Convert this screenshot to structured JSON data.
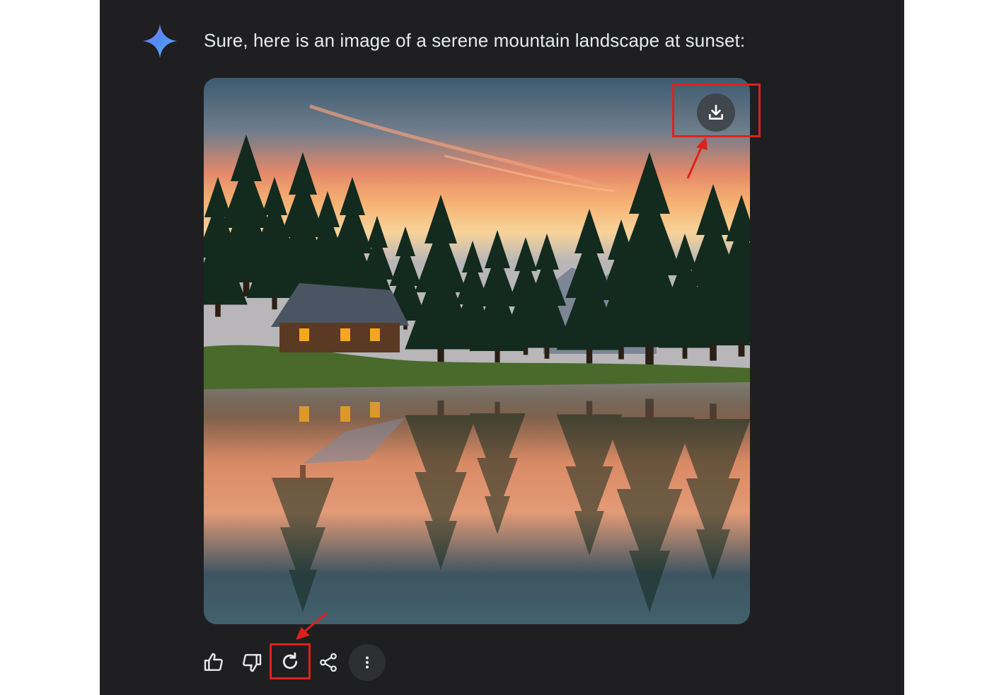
{
  "response": {
    "message": "Sure, here is an image of a serene mountain landscape at sunset:"
  },
  "image": {
    "subject": "mountain lake cabin at sunset",
    "download_icon": "download-icon"
  },
  "actions": [
    {
      "name": "thumbs-up-icon"
    },
    {
      "name": "thumbs-down-icon"
    },
    {
      "name": "regenerate-icon"
    },
    {
      "name": "share-icon"
    },
    {
      "name": "more-options-icon"
    }
  ],
  "colors": {
    "background": "#1f1f21",
    "text": "#e8eaed",
    "highlight": "#e0201b",
    "sparkle_start": "#4f8ef7",
    "sparkle_end": "#a56df2"
  }
}
